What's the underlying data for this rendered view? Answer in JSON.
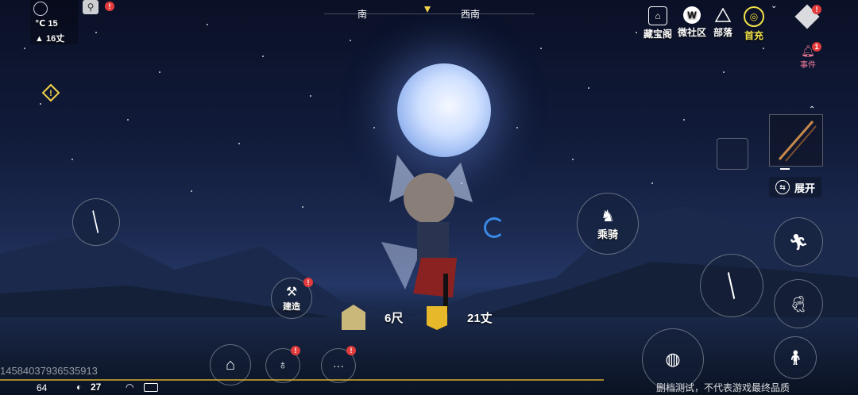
{
  "status": {
    "temperature": "15",
    "temp_unit": "℃",
    "altitude": "16丈"
  },
  "compass": {
    "left_label": "南",
    "right_label": "西南"
  },
  "top_menu": [
    {
      "label": "藏宝阁",
      "icon": "pavilion-icon"
    },
    {
      "label": "微社区",
      "icon": "community-w-icon"
    },
    {
      "label": "部落",
      "icon": "tribe-icon"
    },
    {
      "label": "首充",
      "icon": "first-recharge-icon"
    }
  ],
  "event": {
    "label": "事件",
    "badge": "1"
  },
  "expand_label": "展开",
  "ride_label": "乘骑",
  "build_label": "建造",
  "distance_1": "6尺",
  "distance_2": "21丈",
  "player_id": "14584037936535913",
  "bottom": {
    "fps": "64",
    "ping": "27",
    "disclaimer": "删档测试，不代表游戏最终品质"
  }
}
